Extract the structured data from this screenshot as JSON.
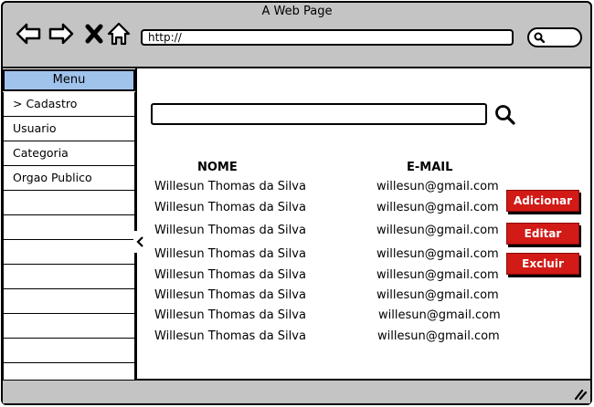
{
  "window": {
    "title": "A Web Page"
  },
  "browser": {
    "url": "http://"
  },
  "sidebar": {
    "header": "Menu",
    "items": [
      "> Cadastro",
      "Usuario",
      "Categoria",
      "Orgao Publico",
      "",
      "",
      "",
      "",
      "",
      "",
      "",
      ""
    ]
  },
  "table": {
    "columns": [
      "NOME",
      "E-MAIL"
    ],
    "rows": [
      [
        "Willesun Thomas da Silva",
        "willesun@gmail.com"
      ],
      [
        "Willesun Thomas da Silva",
        "willesun@gmail.com"
      ],
      [
        "Willesun Thomas da Silva",
        "willesun@gmail.com"
      ],
      [
        "Willesun Thomas da Silva",
        "willesun@gmail.com"
      ],
      [
        "Willesun Thomas da Silva",
        "willesun@gmail.com"
      ],
      [
        "Willesun Thomas da Silva",
        "willesun@gmail.com"
      ],
      [
        "Willesun Thomas da Silva",
        "willesun@gmail.com"
      ],
      [
        "Willesun Thomas da Silva",
        "willesun@gmail.com"
      ]
    ]
  },
  "actions": {
    "add": "Adicionar",
    "edit": "Editar",
    "delete": "Excluir"
  },
  "colors": {
    "menu_header": "#a0c3ec",
    "button": "#d21a17",
    "chrome": "#c4c4c4"
  },
  "icons": [
    "back-arrow-icon",
    "forward-arrow-icon",
    "stop-icon",
    "home-icon",
    "search-icon",
    "chevron-left-icon",
    "resize-grip-icon"
  ]
}
